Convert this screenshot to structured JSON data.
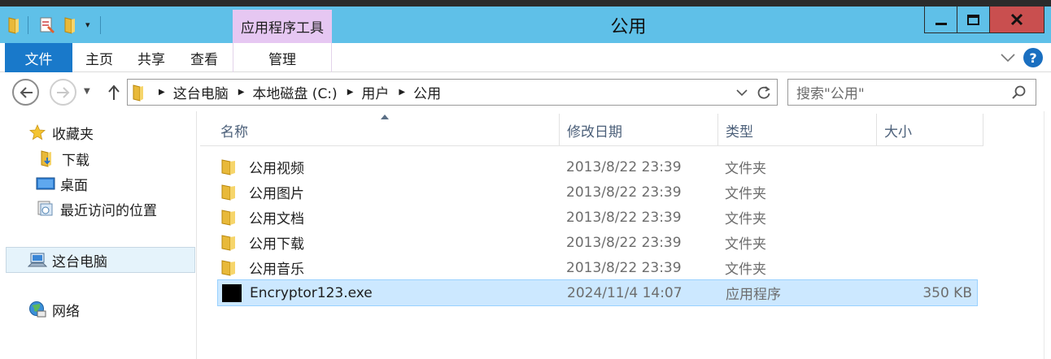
{
  "window": {
    "title": "公用",
    "minimize_label": "",
    "close_symbol": "✕"
  },
  "quick_access": {
    "icons": [
      "folder-icon",
      "properties-icon",
      "new-folder-icon"
    ],
    "dropdown_symbol": "▾"
  },
  "ribbon": {
    "contextual_group": "应用程序工具",
    "tabs": [
      {
        "label": "文件",
        "active": true
      },
      {
        "label": "主页"
      },
      {
        "label": "共享"
      },
      {
        "label": "查看"
      },
      {
        "label": "管理"
      }
    ],
    "help_symbol": "?"
  },
  "navigation": {
    "breadcrumb": [
      "这台电脑",
      "本地磁盘 (C:)",
      "用户",
      "公用"
    ],
    "search_placeholder": "搜索\"公用\""
  },
  "sidebar": {
    "favorites": [
      {
        "label": "收藏夹",
        "icon": "star-icon"
      },
      {
        "label": "下载",
        "icon": "downloads-folder-icon"
      },
      {
        "label": "桌面",
        "icon": "desktop-icon"
      },
      {
        "label": "最近访问的位置",
        "icon": "recent-places-icon"
      }
    ],
    "this_pc": {
      "label": "这台电脑",
      "icon": "computer-icon",
      "selected": true
    },
    "network": {
      "label": "网络",
      "icon": "network-icon"
    }
  },
  "file_list": {
    "columns": [
      "名称",
      "修改日期",
      "类型",
      "大小"
    ],
    "sort_column": "名称",
    "rows": [
      {
        "name": "公用视频",
        "date": "2013/8/22 23:39",
        "type": "文件夹",
        "size": "",
        "icon": "folder-icon"
      },
      {
        "name": "公用图片",
        "date": "2013/8/22 23:39",
        "type": "文件夹",
        "size": "",
        "icon": "folder-icon"
      },
      {
        "name": "公用文档",
        "date": "2013/8/22 23:39",
        "type": "文件夹",
        "size": "",
        "icon": "folder-icon"
      },
      {
        "name": "公用下载",
        "date": "2013/8/22 23:39",
        "type": "文件夹",
        "size": "",
        "icon": "folder-icon"
      },
      {
        "name": "公用音乐",
        "date": "2013/8/22 23:39",
        "type": "文件夹",
        "size": "",
        "icon": "folder-icon"
      },
      {
        "name": "Encryptor123.exe",
        "date": "2024/11/4 14:07",
        "type": "应用程序",
        "size": "350 KB",
        "icon": "exe-icon",
        "selected": true
      }
    ]
  },
  "colors": {
    "titlebar": "#5fc0e8",
    "file_tab": "#1979ca",
    "contextual_tab": "#e6c7f2",
    "close_button": "#c94f4f",
    "selection": "#cce8ff"
  }
}
